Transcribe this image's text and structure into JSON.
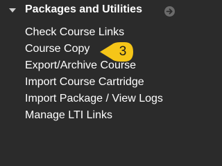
{
  "section": {
    "title": "Packages and Utilities",
    "collapse_icon": "triangle-down-icon",
    "go_icon": "arrow-right-circle-icon"
  },
  "menu": {
    "items": [
      {
        "label": "Check Course Links"
      },
      {
        "label": "Course Copy"
      },
      {
        "label": "Export/Archive Course"
      },
      {
        "label": "Import Course Cartridge"
      },
      {
        "label": "Import Package / View Logs"
      },
      {
        "label": "Manage LTI Links"
      }
    ]
  },
  "callout": {
    "number": "3",
    "color": "#f5c518"
  },
  "colors": {
    "background": "#2b2b2b",
    "text": "#ffffff"
  }
}
